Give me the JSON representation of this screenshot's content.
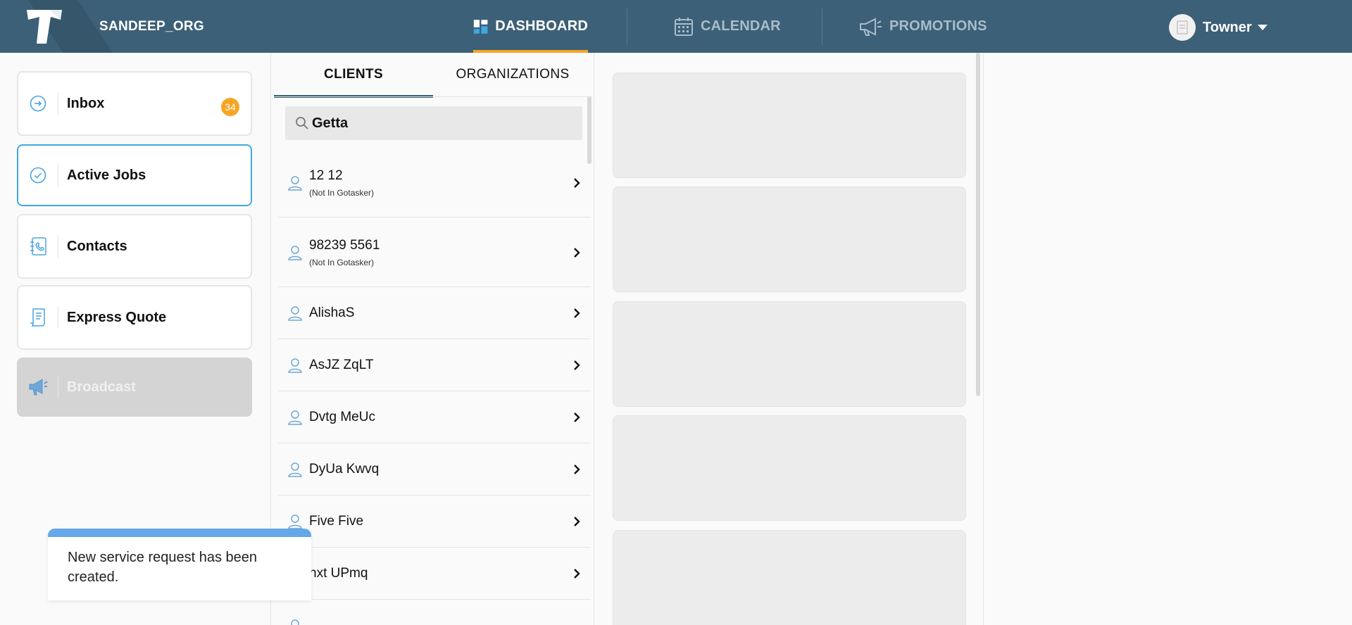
{
  "header": {
    "org_name": "SANDEEP_ORG",
    "nav": [
      {
        "label": "DASHBOARD",
        "icon": "dashboard-icon",
        "active": true
      },
      {
        "label": "CALENDAR",
        "icon": "calendar-icon",
        "active": false
      },
      {
        "label": "PROMOTIONS",
        "icon": "megaphone-icon",
        "active": false
      }
    ],
    "user_name": "Towner",
    "accent_color": "#f5a623",
    "bar_color": "#3c6077"
  },
  "sidebar": {
    "items": [
      {
        "label": "Inbox",
        "icon": "inbox-arrow-icon",
        "badge": "34",
        "state": "normal"
      },
      {
        "label": "Active Jobs",
        "icon": "check-circle-icon",
        "state": "selected"
      },
      {
        "label": "Contacts",
        "icon": "contacts-book-icon",
        "state": "normal"
      },
      {
        "label": "Express Quote",
        "icon": "quote-document-icon",
        "state": "normal"
      },
      {
        "label": "Broadcast",
        "icon": "broadcast-megaphone-icon",
        "state": "disabled"
      }
    ]
  },
  "clients_panel": {
    "tabs": [
      {
        "label": "CLIENTS",
        "active": true
      },
      {
        "label": "ORGANIZATIONS",
        "active": false
      }
    ],
    "search_value": "Getta",
    "clients": [
      {
        "name": "12 12",
        "sub": "(Not In Gotasker)"
      },
      {
        "name": "98239 5561",
        "sub": "(Not In Gotasker)"
      },
      {
        "name": "AlishaS"
      },
      {
        "name": "AsJZ ZqLT"
      },
      {
        "name": "Dvtg MeUc"
      },
      {
        "name": "DyUa Kwvq"
      },
      {
        "name": "Five Five"
      },
      {
        "name": "nxt UPmq"
      }
    ]
  },
  "toast": {
    "message": "New service request has been created."
  }
}
